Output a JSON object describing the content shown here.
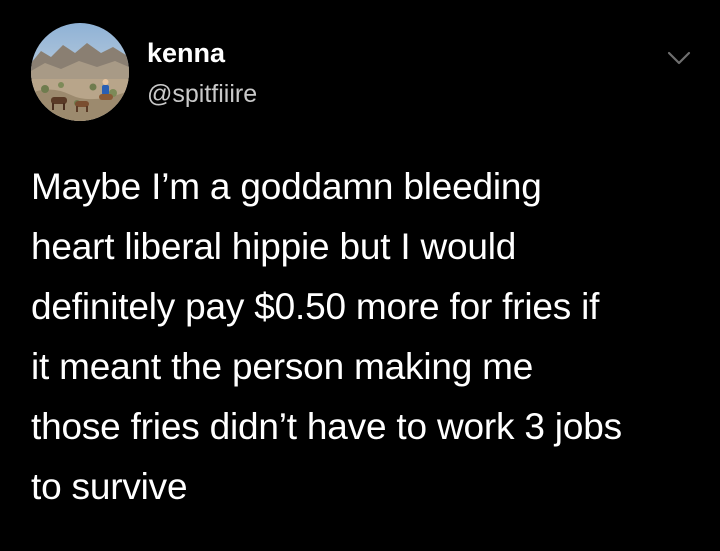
{
  "author": {
    "display_name": "kenna",
    "handle": "@spitfiiire"
  },
  "tweet": {
    "lines": [
      "Maybe I’m a goddamn bleeding",
      "heart liberal hippie but I would",
      "definitely pay $0.50 more for fries if",
      "it meant the person making me",
      "those fries didn’t have to work 3 jobs",
      "to survive"
    ]
  },
  "icons": {
    "options": "chevron-down-icon",
    "avatar": "profile-photo"
  },
  "colors": {
    "background": "#000000",
    "text": "#ffffff",
    "handle": "#c9c9c9",
    "chevron": "#6e6e6e"
  }
}
